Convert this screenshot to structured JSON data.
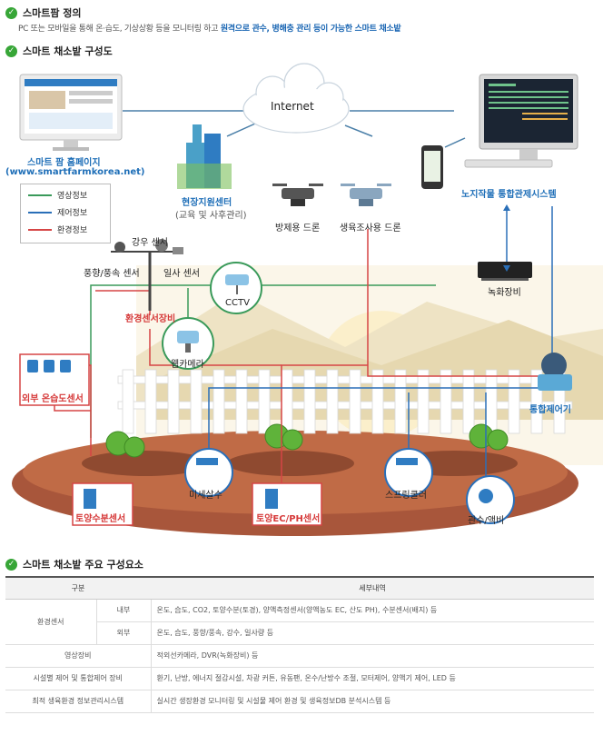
{
  "section1": {
    "title": "스마트팜 정의"
  },
  "intro": {
    "text": "PC 또는 모바일을 통해 온·습도, 기상상황 등을 모니터링 하고 ",
    "highlight": "원격으로 관수, 병해충 관리 등이 가능한 스마트 채소밭"
  },
  "section2": {
    "title": "스마트 채소밭 구성도"
  },
  "diagram": {
    "internet": "Internet",
    "homepage_title": "스마트 팜 홈페이지",
    "homepage_url": "(www.smartfarmkorea.net)",
    "center_title": "현장지원센터",
    "center_sub": "(교육 및 사후관리)",
    "control_system": "노지작물 통합관제시스템",
    "drone_spray": "방제용 드론",
    "drone_survey": "생육조사용 드론",
    "rain_sensor": "강우 센서",
    "wind_sensor": "풍향/풍속 센서",
    "solar_sensor": "일사 센서",
    "env_equipment": "환경센서장비",
    "cctv": "CCTV",
    "webcam": "웹카메라",
    "recorder": "녹화장비",
    "outdoor_sensor": "외부 온습도센서",
    "integrated_controller": "통합제어기",
    "soil_moisture": "토양수분센서",
    "mist_spray": "미세살수",
    "soil_ec": "토양EC/PH센서",
    "sprinkler": "스프링쿨러",
    "fertigation": "관수/액비",
    "legend": [
      {
        "label": "영상정보",
        "color": "#3a9a5a"
      },
      {
        "label": "제어정보",
        "color": "#2a6fb8"
      },
      {
        "label": "환경정보",
        "color": "#d64545"
      }
    ]
  },
  "section3": {
    "title": "스마트 채소밭 주요 구성요소"
  },
  "table": {
    "headers": [
      "구분",
      "세부내역"
    ],
    "env_sensor": "환경센서",
    "inner": "내부",
    "inner_detail": "온도, 습도, CO2, 토양수분(토경), 양액측정센서(양액농도 EC, 산도 PH), 수분센서(배지) 등",
    "outer": "외부",
    "outer_detail": "온도, 습도, 풍향/풍속, 강수, 일사량 등",
    "video": "영상장비",
    "video_detail": "적외선카메라, DVR(녹화장비) 등",
    "facility": "시설별 제어 및 통합제어 장비",
    "facility_detail": "환기, 난방, 에너지 절감시설, 차광 커튼, 유동팬, 온수/난방수 조절, 모터제어, 양액기 제어, LED 등",
    "system": "최적 생육환경 정보관리시스템",
    "system_detail": "실시간 생장환경 모니터링 및 시설물 제어 환경 및 생육정보DB 분석시스템 등"
  }
}
